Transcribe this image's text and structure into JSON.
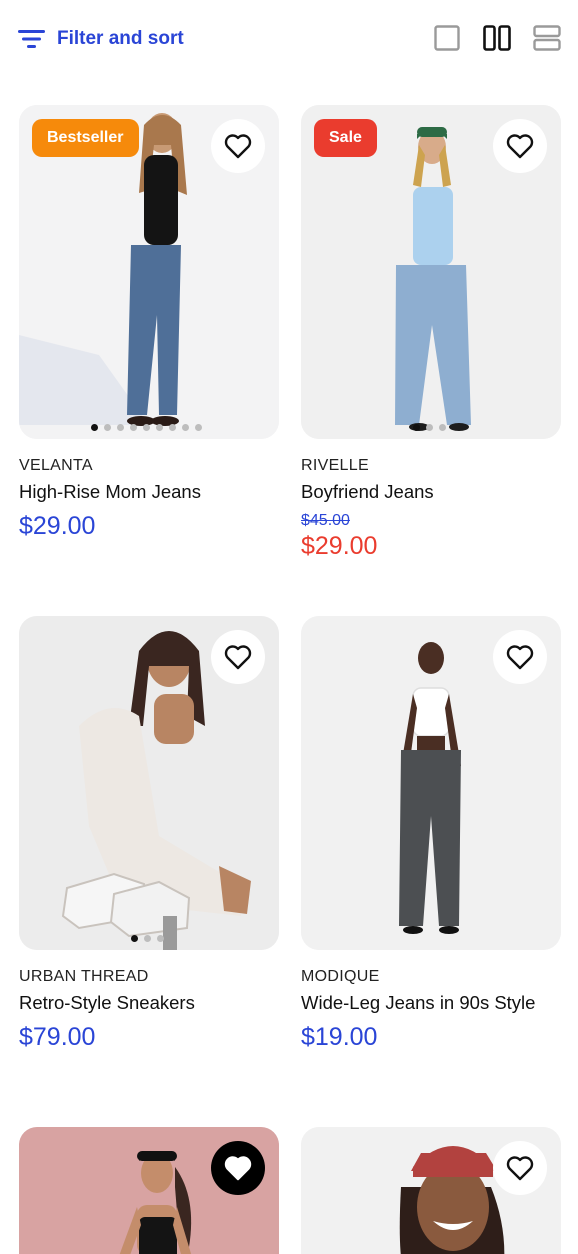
{
  "toolbar": {
    "filter_label": "Filter and sort",
    "view_options": [
      "single-column",
      "two-column",
      "list"
    ],
    "active_view": "two-column"
  },
  "colors": {
    "accent": "#2a45d6",
    "sale": "#ea3c2e",
    "bestseller": "#f68a0b"
  },
  "products": [
    {
      "brand": "VELANTA",
      "name": "High-Rise Mom Jeans",
      "price": "$29.00",
      "badge": "Bestseller",
      "favorited": false,
      "image_count": 9,
      "image_index": 1
    },
    {
      "brand": "RIVELLE",
      "name": "Boyfriend Jeans",
      "old_price": "$45.00",
      "price": "$29.00",
      "badge": "Sale",
      "favorited": false,
      "image_count": 3,
      "image_index": 1
    },
    {
      "brand": "URBAN THREAD",
      "name": "Retro-Style Sneakers",
      "price": "$79.00",
      "favorited": false,
      "image_count": 3,
      "image_index": 1
    },
    {
      "brand": "MODIQUE",
      "name": "Wide-Leg Jeans in 90s Style",
      "price": "$19.00",
      "favorited": false
    },
    {
      "favorited": true
    },
    {
      "favorited": false
    }
  ]
}
